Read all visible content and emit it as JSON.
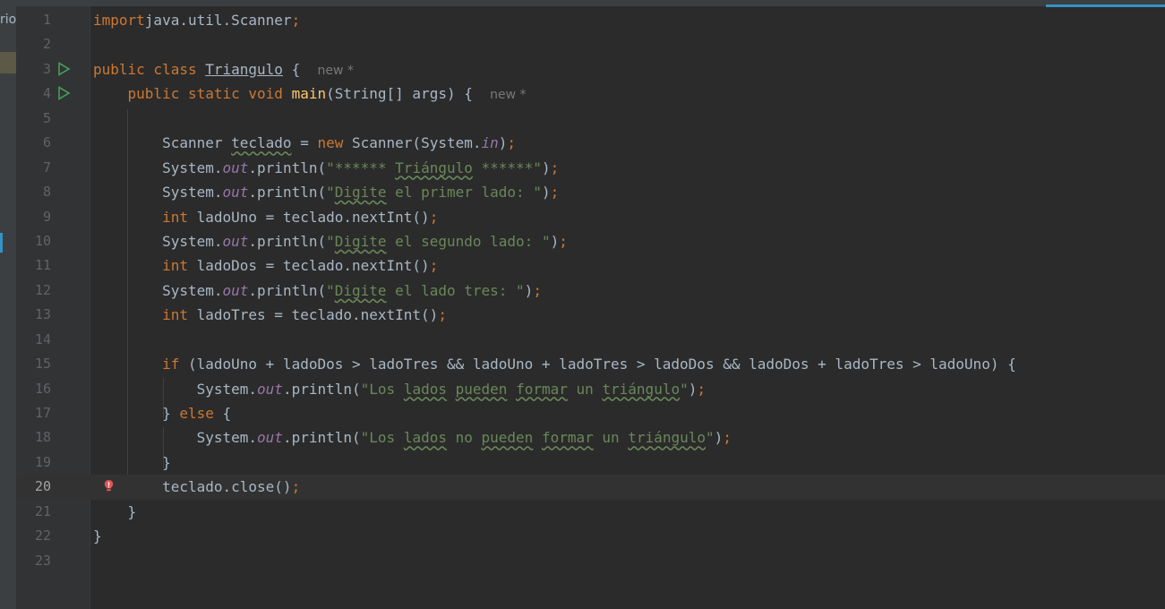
{
  "sidebar": {
    "project_text": "rio"
  },
  "editor": {
    "current_line": 20,
    "lines": [
      {
        "n": "1",
        "parts": [
          [
            "kw",
            "import"
          ],
          [
            "",
            "java.util.Scanner"
          ],
          [
            "kw",
            ";"
          ]
        ]
      },
      {
        "n": "2",
        "parts": []
      },
      {
        "n": "3",
        "run": true,
        "parts": [
          [
            "kw",
            "public class "
          ],
          [
            "ul",
            "Triangulo"
          ],
          [
            "",
            " {  "
          ],
          [
            "hint",
            "new *"
          ]
        ]
      },
      {
        "n": "4",
        "run": true,
        "parts": [
          [
            "",
            "    "
          ],
          [
            "kw",
            "public static void "
          ],
          [
            "mth",
            "main"
          ],
          [
            "",
            "(String[] args) {  "
          ],
          [
            "hint",
            "new *"
          ]
        ]
      },
      {
        "n": "5",
        "parts": []
      },
      {
        "n": "6",
        "parts": [
          [
            "",
            "        Scanner "
          ],
          [
            "wavyp",
            "teclado"
          ],
          [
            "",
            " = "
          ],
          [
            "kw",
            "new "
          ],
          [
            "",
            "Scanner(System."
          ],
          [
            "fld",
            "in"
          ],
          [
            "",
            ")"
          ],
          [
            "kw",
            ";"
          ]
        ]
      },
      {
        "n": "7",
        "parts": [
          [
            "",
            "        System."
          ],
          [
            "fld",
            "out"
          ],
          [
            "",
            ".println("
          ],
          [
            "str",
            "\"****** "
          ],
          [
            "wavy",
            "Triángulo"
          ],
          [
            "str",
            " ******\""
          ],
          [
            "",
            ")"
          ],
          [
            "kw",
            ";"
          ]
        ]
      },
      {
        "n": "8",
        "parts": [
          [
            "",
            "        System."
          ],
          [
            "fld",
            "out"
          ],
          [
            "",
            ".println("
          ],
          [
            "str",
            "\""
          ],
          [
            "wavy",
            "Digite"
          ],
          [
            "str",
            " el primer lado: \""
          ],
          [
            "",
            ")"
          ],
          [
            "kw",
            ";"
          ]
        ]
      },
      {
        "n": "9",
        "parts": [
          [
            "",
            "        "
          ],
          [
            "kw",
            "int "
          ],
          [
            "",
            "ladoUno = teclado.nextInt()"
          ],
          [
            "kw",
            ";"
          ]
        ]
      },
      {
        "n": "10",
        "parts": [
          [
            "",
            "        System."
          ],
          [
            "fld",
            "out"
          ],
          [
            "",
            ".println("
          ],
          [
            "str",
            "\""
          ],
          [
            "wavy",
            "Digite"
          ],
          [
            "str",
            " el segundo lado: \""
          ],
          [
            "",
            ")"
          ],
          [
            "kw",
            ";"
          ]
        ]
      },
      {
        "n": "11",
        "parts": [
          [
            "",
            "        "
          ],
          [
            "kw",
            "int "
          ],
          [
            "",
            "ladoDos = teclado.nextInt()"
          ],
          [
            "kw",
            ";"
          ]
        ]
      },
      {
        "n": "12",
        "parts": [
          [
            "",
            "        System."
          ],
          [
            "fld",
            "out"
          ],
          [
            "",
            ".println("
          ],
          [
            "str",
            "\""
          ],
          [
            "wavy",
            "Digite"
          ],
          [
            "str",
            " el lado tres: \""
          ],
          [
            "",
            ")"
          ],
          [
            "kw",
            ";"
          ]
        ]
      },
      {
        "n": "13",
        "parts": [
          [
            "",
            "        "
          ],
          [
            "kw",
            "int "
          ],
          [
            "",
            "ladoTres = teclado.nextInt()"
          ],
          [
            "kw",
            ";"
          ]
        ]
      },
      {
        "n": "14",
        "parts": []
      },
      {
        "n": "15",
        "parts": [
          [
            "",
            "        "
          ],
          [
            "kw",
            "if "
          ],
          [
            "",
            "(ladoUno + ladoDos > ladoTres && ladoUno + ladoTres > ladoDos && ladoDos + ladoTres > ladoUno) {"
          ]
        ]
      },
      {
        "n": "16",
        "parts": [
          [
            "",
            "            System."
          ],
          [
            "fld",
            "out"
          ],
          [
            "",
            ".println("
          ],
          [
            "str",
            "\"Los "
          ],
          [
            "wavy",
            "lados"
          ],
          [
            "str",
            " "
          ],
          [
            "wavy",
            "pueden"
          ],
          [
            "str",
            " "
          ],
          [
            "wavy",
            "formar"
          ],
          [
            "str",
            " un "
          ],
          [
            "wavy",
            "triángulo"
          ],
          [
            "str",
            "\""
          ],
          [
            "",
            ")"
          ],
          [
            "kw",
            ";"
          ]
        ]
      },
      {
        "n": "17",
        "parts": [
          [
            "",
            "        } "
          ],
          [
            "kw",
            "else "
          ],
          [
            "",
            "{"
          ]
        ]
      },
      {
        "n": "18",
        "parts": [
          [
            "",
            "            System."
          ],
          [
            "fld",
            "out"
          ],
          [
            "",
            ".println("
          ],
          [
            "str",
            "\"Los "
          ],
          [
            "wavy",
            "lados"
          ],
          [
            "str",
            " no "
          ],
          [
            "wavy",
            "pueden"
          ],
          [
            "str",
            " "
          ],
          [
            "wavy",
            "formar"
          ],
          [
            "str",
            " un "
          ],
          [
            "wavy",
            "triángulo"
          ],
          [
            "str",
            "\""
          ],
          [
            "",
            ")"
          ],
          [
            "kw",
            ";"
          ]
        ]
      },
      {
        "n": "19",
        "parts": [
          [
            "",
            "        }"
          ]
        ]
      },
      {
        "n": "20",
        "err": true,
        "parts": [
          [
            "",
            "        teclado.close()"
          ],
          [
            "kw",
            ";"
          ]
        ]
      },
      {
        "n": "21",
        "parts": [
          [
            "",
            "    }"
          ]
        ]
      },
      {
        "n": "22",
        "parts": [
          [
            "",
            "}"
          ]
        ]
      },
      {
        "n": "23",
        "parts": []
      }
    ]
  }
}
